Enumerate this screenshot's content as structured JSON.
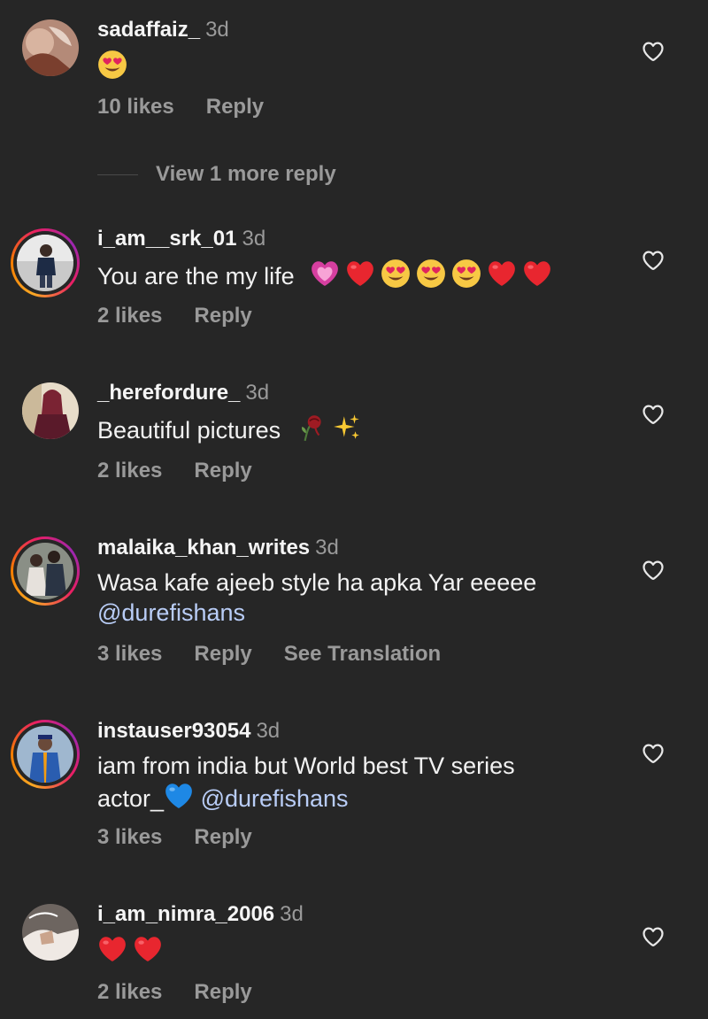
{
  "comments": [
    {
      "username": "sadaffaiz_",
      "time": "3d",
      "emojis": [
        "heart-eyes"
      ],
      "likes": "10 likes",
      "reply": "Reply",
      "view_more": "View 1 more reply"
    },
    {
      "username": "i_am__srk_01",
      "time": "3d",
      "text": "You are the my life",
      "emojis": [
        "pink-heart",
        "red-heart",
        "heart-eyes",
        "heart-eyes",
        "heart-eyes",
        "red-heart",
        "red-heart"
      ],
      "likes": "2 likes",
      "reply": "Reply"
    },
    {
      "username": "_herefordure_",
      "time": "3d",
      "text": "Beautiful pictures",
      "emojis": [
        "wilted-rose",
        "sparkles"
      ],
      "likes": "2 likes",
      "reply": "Reply"
    },
    {
      "username": "malaika_khan_writes",
      "time": "3d",
      "text": "Wasa kafe ajeeb style ha apka Yar eeeee",
      "mention": "@durefishans",
      "likes": "3 likes",
      "reply": "Reply",
      "translate": "See Translation"
    },
    {
      "username": "instauser93054",
      "time": "3d",
      "text_line1": "iam from india but World best TV series",
      "text_line2": "actor_",
      "emojis": [
        "blue-heart"
      ],
      "mention": "@durefishans",
      "likes": "3 likes",
      "reply": "Reply"
    },
    {
      "username": "i_am_nimra_2006",
      "time": "3d",
      "emojis": [
        "red-heart",
        "red-heart"
      ],
      "likes": "2 likes",
      "reply": "Reply"
    }
  ],
  "colors": {
    "background": "#262626",
    "secondary_text": "#9a9a9a",
    "mention": "#b9cdf7"
  },
  "icons": {
    "like": "heart-outline-icon"
  }
}
